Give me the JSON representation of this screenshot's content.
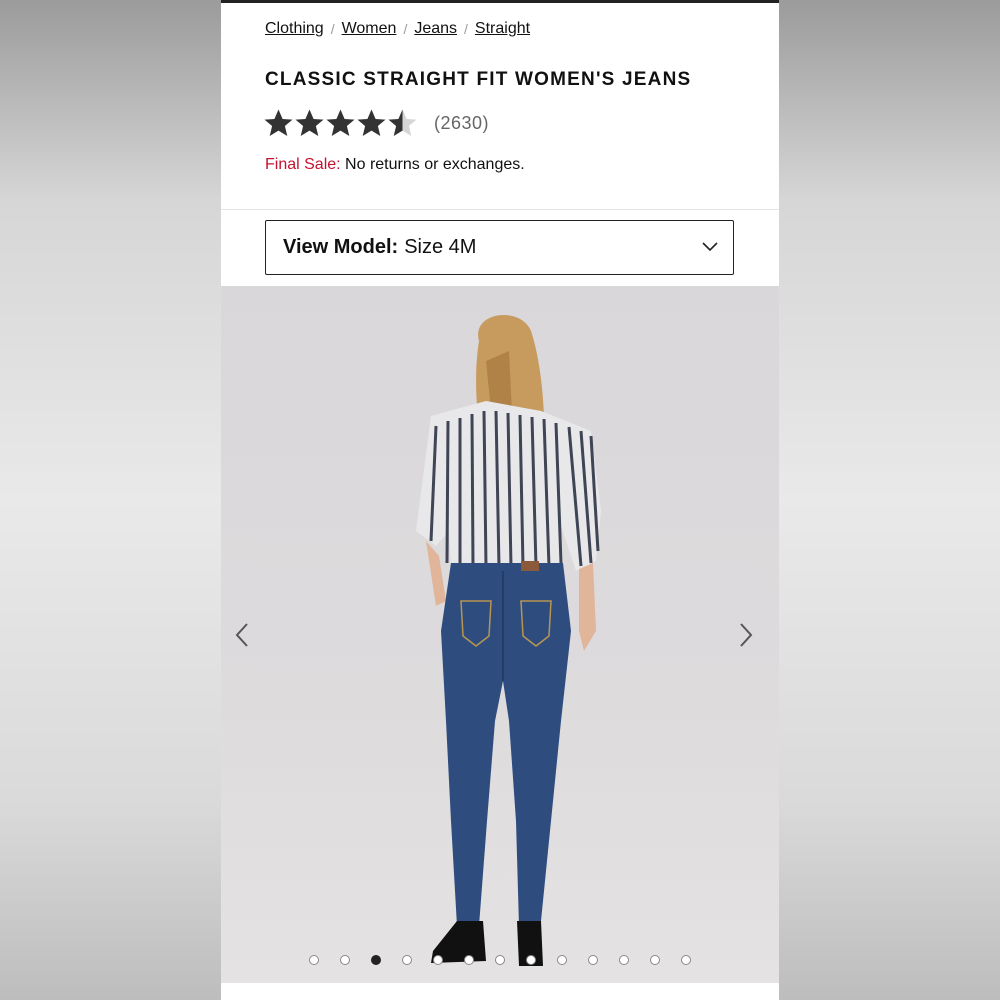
{
  "breadcrumb": {
    "items": [
      "Clothing",
      "Women",
      "Jeans",
      "Straight"
    ],
    "separator": "/"
  },
  "product": {
    "title": "CLASSIC STRAIGHT FIT WOMEN'S JEANS",
    "rating": 4.5,
    "rating_max": 5,
    "review_count": "(2630)"
  },
  "final_sale": {
    "label": "Final Sale:",
    "text": "No returns or exchanges."
  },
  "view_model": {
    "label": "View Model:",
    "value": "Size 4M"
  },
  "gallery": {
    "image_subject": "model-back-view-straight-jeans",
    "dot_count": 13,
    "active_index": 2
  },
  "icons": {
    "prev": "chevron-left-icon",
    "next": "chevron-right-icon",
    "dropdown": "chevron-down-icon",
    "star": "star-icon"
  },
  "colors": {
    "sale_red": "#c41230",
    "star_fill": "#333333",
    "star_empty": "#d6d6d6"
  }
}
